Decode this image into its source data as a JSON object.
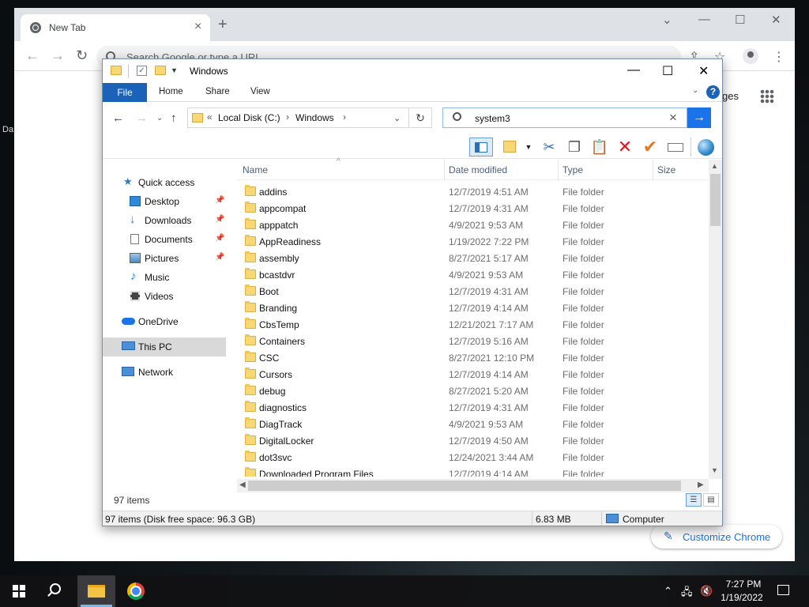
{
  "chrome": {
    "tab_title": "New Tab",
    "omnibox_placeholder": "Search Google or type a URL",
    "images_link": "ges",
    "customize_label": "Customize Chrome"
  },
  "desktop": {
    "fragment_label": "Da"
  },
  "explorer": {
    "window_title": "Windows",
    "ribbon_tabs": {
      "file": "File",
      "home": "Home",
      "share": "Share",
      "view": "View"
    },
    "address": {
      "prefix": "«",
      "crumbs": [
        "Local Disk (C:)",
        "Windows"
      ]
    },
    "search_value": "system3",
    "nav_pane": {
      "quick_access": "Quick access",
      "desktop": "Desktop",
      "downloads": "Downloads",
      "documents": "Documents",
      "pictures": "Pictures",
      "music": "Music",
      "videos": "Videos",
      "onedrive": "OneDrive",
      "this_pc": "This PC",
      "network": "Network"
    },
    "columns": {
      "name": "Name",
      "date": "Date modified",
      "type": "Type",
      "size": "Size"
    },
    "files": [
      {
        "name": "addins",
        "date": "12/7/2019 4:51 AM",
        "type": "File folder"
      },
      {
        "name": "appcompat",
        "date": "12/7/2019 4:31 AM",
        "type": "File folder"
      },
      {
        "name": "apppatch",
        "date": "4/9/2021 9:53 AM",
        "type": "File folder"
      },
      {
        "name": "AppReadiness",
        "date": "1/19/2022 7:22 PM",
        "type": "File folder"
      },
      {
        "name": "assembly",
        "date": "8/27/2021 5:17 AM",
        "type": "File folder"
      },
      {
        "name": "bcastdvr",
        "date": "4/9/2021 9:53 AM",
        "type": "File folder"
      },
      {
        "name": "Boot",
        "date": "12/7/2019 4:31 AM",
        "type": "File folder"
      },
      {
        "name": "Branding",
        "date": "12/7/2019 4:14 AM",
        "type": "File folder"
      },
      {
        "name": "CbsTemp",
        "date": "12/21/2021 7:17 AM",
        "type": "File folder"
      },
      {
        "name": "Containers",
        "date": "12/7/2019 5:16 AM",
        "type": "File folder"
      },
      {
        "name": "CSC",
        "date": "8/27/2021 12:10 PM",
        "type": "File folder"
      },
      {
        "name": "Cursors",
        "date": "12/7/2019 4:14 AM",
        "type": "File folder"
      },
      {
        "name": "debug",
        "date": "8/27/2021 5:20 AM",
        "type": "File folder"
      },
      {
        "name": "diagnostics",
        "date": "12/7/2019 4:31 AM",
        "type": "File folder"
      },
      {
        "name": "DiagTrack",
        "date": "4/9/2021 9:53 AM",
        "type": "File folder"
      },
      {
        "name": "DigitalLocker",
        "date": "12/7/2019 4:50 AM",
        "type": "File folder"
      },
      {
        "name": "dot3svc",
        "date": "12/24/2021 3:44 AM",
        "type": "File folder"
      },
      {
        "name": "Downloaded Program Files",
        "date": "12/7/2019 4:14 AM",
        "type": "File folder"
      }
    ],
    "item_count": "97 items",
    "status": {
      "items_info": "97 items (Disk free space: 96.3 GB)",
      "size": "6.83 MB",
      "location": "Computer"
    }
  },
  "taskbar": {
    "time": "7:27 PM",
    "date": "1/19/2022"
  },
  "colors": {
    "accent": "#1a63b8",
    "chrome_blue": "#1a73e8",
    "folder": "#f8d775",
    "delete_red": "#e81123",
    "check_orange": "#e87722"
  },
  "icons": [
    "chrome-logo-icon",
    "folder-icon",
    "search-icon",
    "refresh-icon",
    "cut-icon",
    "copy-icon",
    "paste-icon",
    "delete-icon",
    "checkmark-icon",
    "rename-icon",
    "globe-icon",
    "pin-icon",
    "windows-start-icon",
    "notification-icon"
  ]
}
